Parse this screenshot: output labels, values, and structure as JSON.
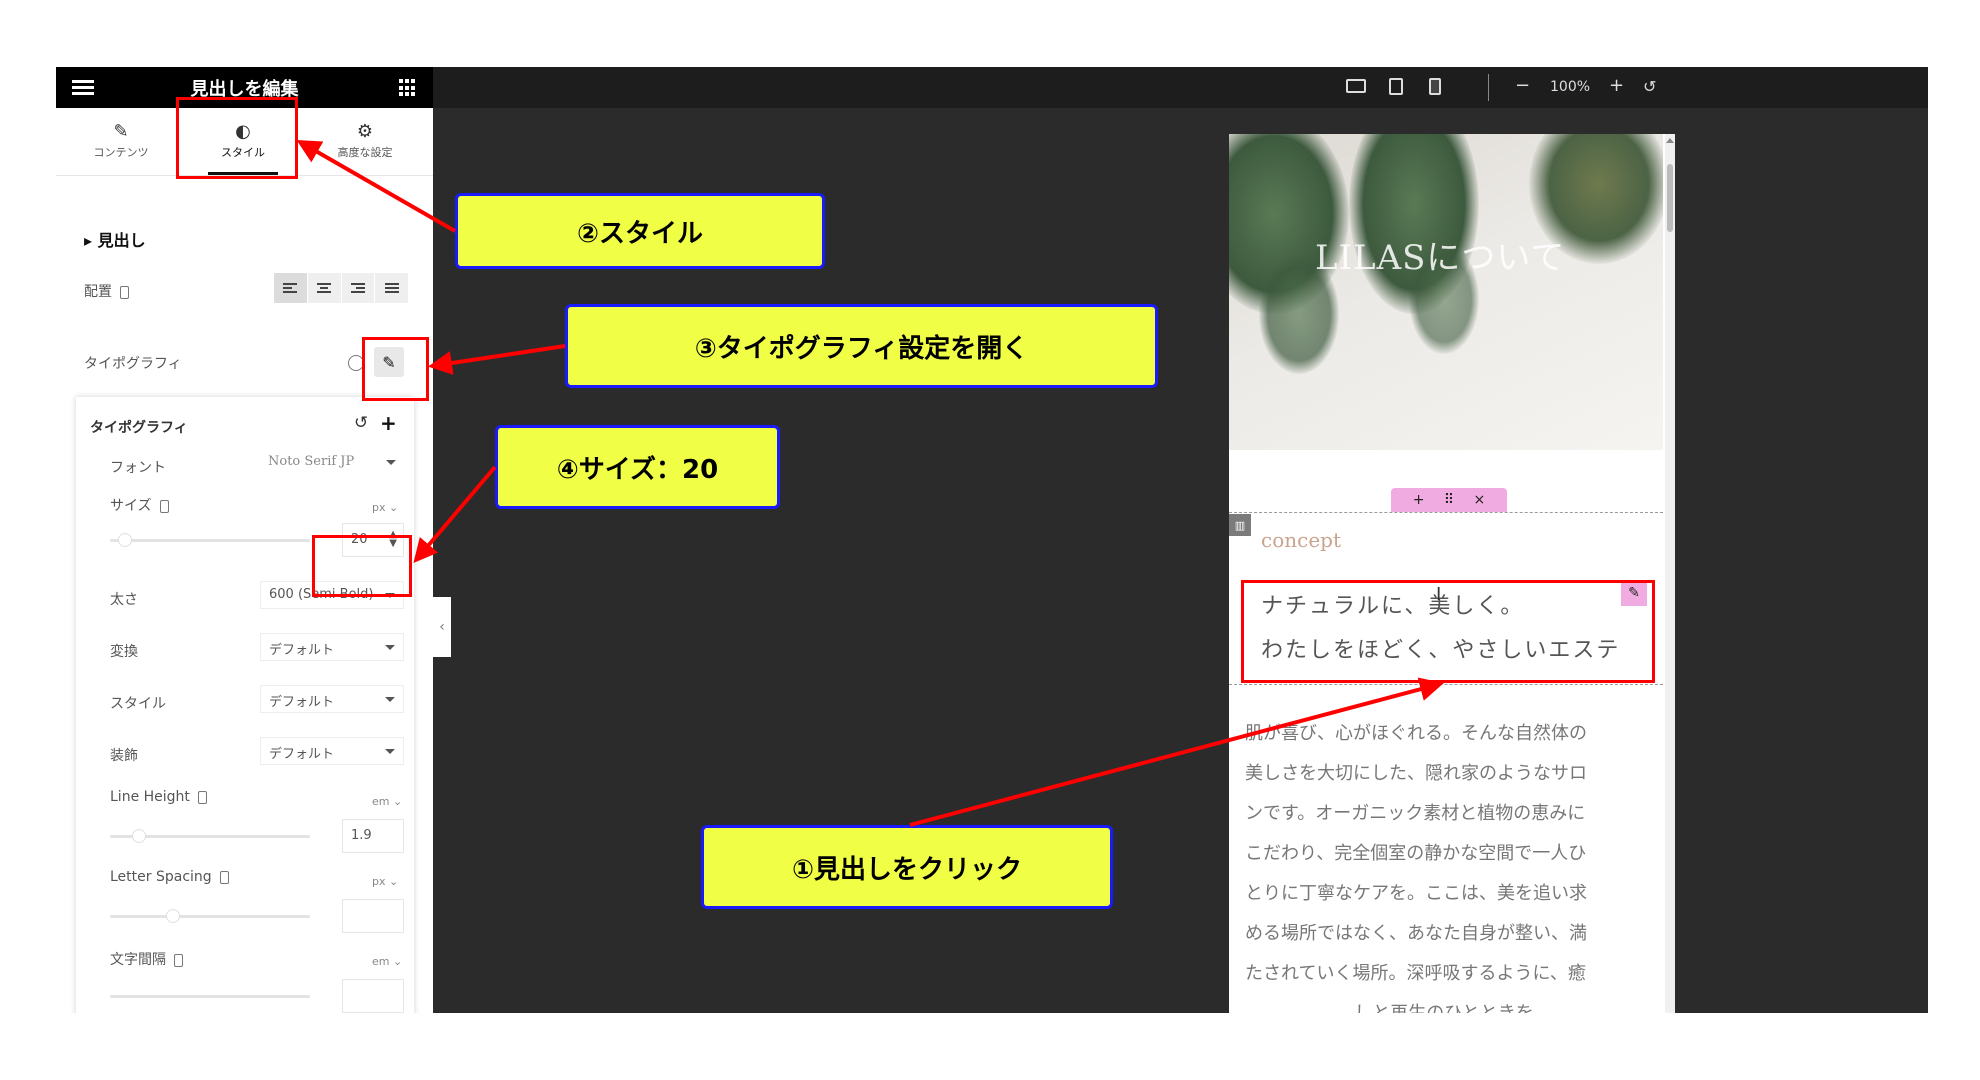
{
  "panel": {
    "title": "見出しを編集",
    "tabs": [
      {
        "label": "コンテンツ",
        "icon": "pencil-icon"
      },
      {
        "label": "スタイル",
        "icon": "half-circle-icon"
      },
      {
        "label": "高度な設定",
        "icon": "gear-icon"
      }
    ],
    "section_title": "見出し",
    "alignment_label": "配置",
    "typography_label": "タイポグラフィ"
  },
  "typography_card": {
    "title": "タイポグラフィ",
    "font_label": "フォント",
    "font_value": "Noto Serif JP",
    "size_label": "サイズ",
    "size_unit": "px",
    "size_value": "20",
    "weight_label": "太さ",
    "weight_value": "600 (Semi Bold)",
    "transform_label": "変換",
    "transform_value": "デフォルト",
    "style_label": "スタイル",
    "style_value": "デフォルト",
    "decoration_label": "装飾",
    "decoration_value": "デフォルト",
    "line_height_label": "Line Height",
    "line_height_unit": "em",
    "line_height_value": "1.9",
    "letter_spacing_label": "Letter Spacing",
    "letter_spacing_unit": "px",
    "word_spacing_label": "文字間隔",
    "word_spacing_unit": "em"
  },
  "toolbar": {
    "zoom": "100%",
    "zoom_out": "−",
    "zoom_in": "+",
    "reset": "↺"
  },
  "preview": {
    "hero_text": "LILASについて",
    "element_toolbar": {
      "add": "+",
      "move": "⠿",
      "close": "×"
    },
    "subheading": "concept",
    "heading_lines": [
      "ナチュラルに、美しく。",
      "わたしをほどく、やさしいエステ"
    ],
    "body_lines": [
      "肌が喜び、心がほぐれる。そんな自然体の",
      "美しさを大切にした、隠れ家のようなサロ",
      "ンです。オーガニック素材と植物の恵みに",
      "こだわり、完全個室の静かな空間で一人ひ",
      "とりに丁寧なケアを。ここは、美を追い求",
      "める場所ではなく、あなた自身が整い、満",
      "たされていく場所。深呼吸するように、癒",
      "しと再生のひとときを。"
    ]
  },
  "annotations": {
    "step1": "①見出しをクリック",
    "step2": "②スタイル",
    "step3": "③タイポグラフィ設定を開く",
    "step4": "④サイズ：20",
    "colors": {
      "highlight": "#ff0000",
      "callout_bg": "#f0ff45",
      "callout_border": "#1a1aff"
    }
  }
}
